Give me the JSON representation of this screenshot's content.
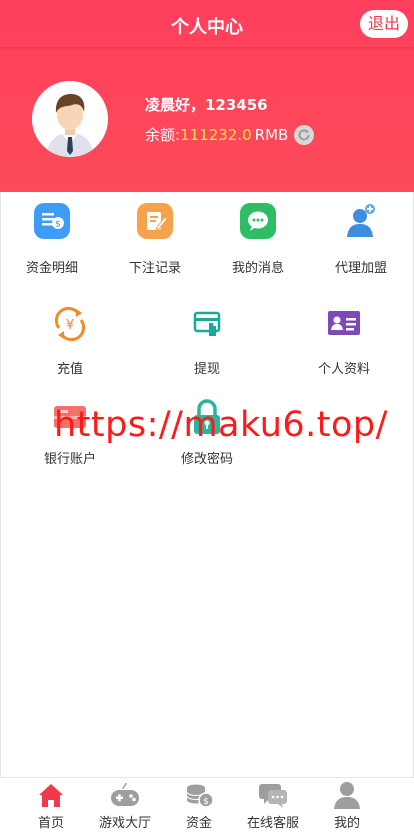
{
  "topbar": {
    "title": "个人中心",
    "logout_label": "退出"
  },
  "profile": {
    "greeting": "凌晨好，123456",
    "balance_label": "余额:",
    "balance_value": "111232.0",
    "balance_unit": "RMB"
  },
  "menu_row1": [
    {
      "label": "资金明细",
      "icon": "fund-detail-icon"
    },
    {
      "label": "下注记录",
      "icon": "bet-record-icon"
    },
    {
      "label": "我的消息",
      "icon": "message-icon"
    },
    {
      "label": "代理加盟",
      "icon": "agent-join-icon"
    }
  ],
  "menu_row2": [
    {
      "label": "充值",
      "icon": "recharge-icon"
    },
    {
      "label": "提现",
      "icon": "withdraw-icon"
    },
    {
      "label": "个人资料",
      "icon": "profile-card-icon"
    }
  ],
  "menu_row3": [
    {
      "label": "银行账户",
      "icon": "bank-card-icon"
    },
    {
      "label": "修改密码",
      "icon": "lock-icon"
    }
  ],
  "watermark": "https://maku6.top/",
  "tabbar": [
    {
      "label": "首页",
      "icon": "home-icon",
      "active": true
    },
    {
      "label": "游戏大厅",
      "icon": "gamepad-icon"
    },
    {
      "label": "资金",
      "icon": "coins-icon"
    },
    {
      "label": "在线客服",
      "icon": "chat-icon"
    },
    {
      "label": "我的",
      "icon": "user-icon"
    }
  ],
  "colors": {
    "brand": "#fe3f5c",
    "balance": "#ffe34d"
  }
}
